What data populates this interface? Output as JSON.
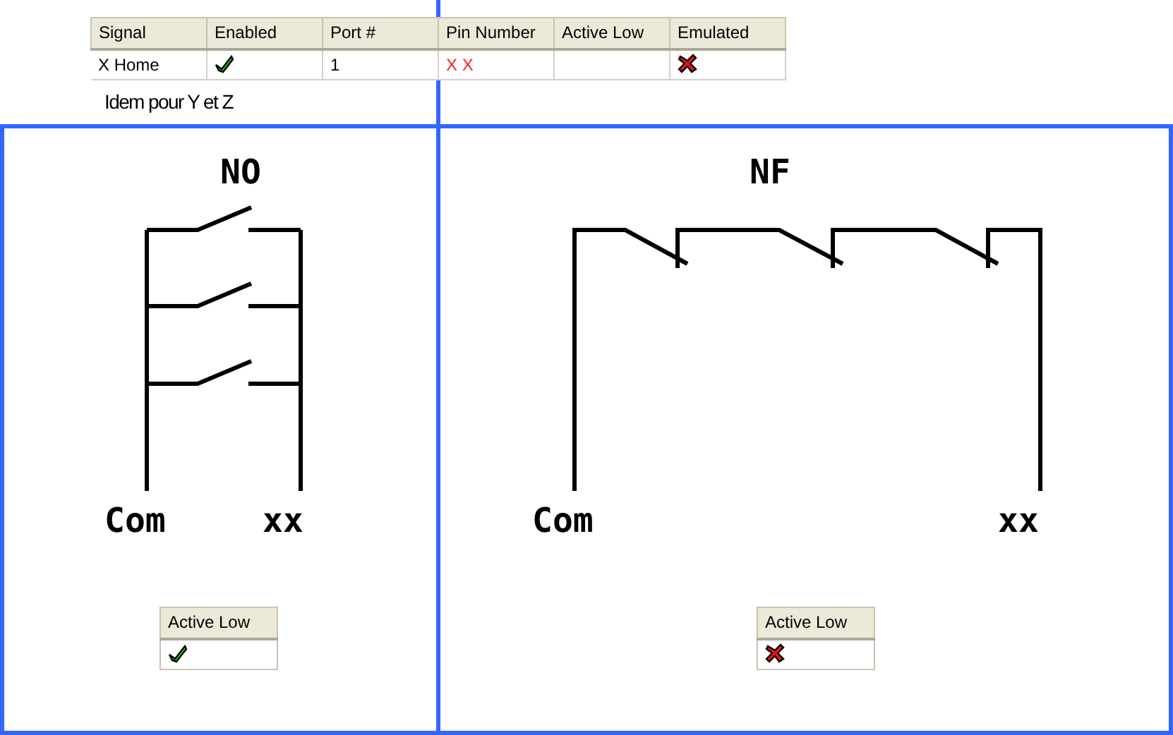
{
  "signal_table": {
    "columns": [
      "Signal",
      "Enabled",
      "Port #",
      "Pin Number",
      "Active Low",
      "Emulated"
    ],
    "rows": [
      {
        "signal": "X Home",
        "enabled": true,
        "port": "1",
        "pin_number": "X X",
        "emulated": false
      }
    ]
  },
  "note": "Idem pour Y et Z",
  "diagrams": [
    {
      "kind": "parallel",
      "title": "NO",
      "left_label": "Com",
      "right_label": "xx",
      "table": {
        "header": "Active Low",
        "checked": true
      }
    },
    {
      "kind": "series",
      "title": "NF",
      "left_label": "Com",
      "right_label": "xx",
      "table": {
        "header": "Active Low",
        "checked": false
      }
    }
  ]
}
